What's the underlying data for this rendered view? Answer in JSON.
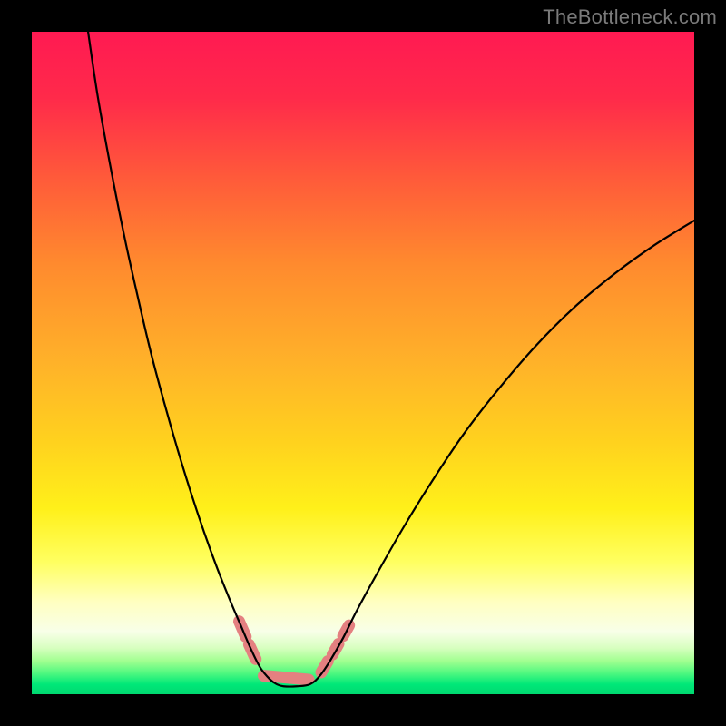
{
  "watermark": "TheBottleneck.com",
  "chart_data": {
    "type": "line",
    "title": "",
    "xlabel": "",
    "ylabel": "",
    "xlim": [
      0,
      100
    ],
    "ylim": [
      0,
      100
    ],
    "gradient_stops": [
      {
        "offset": 0.0,
        "color": "#ff1a52"
      },
      {
        "offset": 0.1,
        "color": "#ff2a4a"
      },
      {
        "offset": 0.22,
        "color": "#ff5a3a"
      },
      {
        "offset": 0.35,
        "color": "#ff8a2e"
      },
      {
        "offset": 0.5,
        "color": "#ffb229"
      },
      {
        "offset": 0.62,
        "color": "#ffd21e"
      },
      {
        "offset": 0.72,
        "color": "#fff01a"
      },
      {
        "offset": 0.8,
        "color": "#ffff60"
      },
      {
        "offset": 0.86,
        "color": "#ffffc0"
      },
      {
        "offset": 0.905,
        "color": "#f8ffe8"
      },
      {
        "offset": 0.93,
        "color": "#d8ffc0"
      },
      {
        "offset": 0.95,
        "color": "#a0ff90"
      },
      {
        "offset": 0.968,
        "color": "#50f880"
      },
      {
        "offset": 0.985,
        "color": "#00e878"
      },
      {
        "offset": 1.0,
        "color": "#00d870"
      }
    ],
    "series": [
      {
        "name": "bottleneck-curve",
        "stroke": "#000000",
        "stroke_width": 2.2,
        "points": [
          {
            "x": 8.5,
            "y": 100.0
          },
          {
            "x": 10.0,
            "y": 90.0
          },
          {
            "x": 12.0,
            "y": 79.0
          },
          {
            "x": 14.0,
            "y": 69.0
          },
          {
            "x": 16.0,
            "y": 60.0
          },
          {
            "x": 18.0,
            "y": 51.5
          },
          {
            "x": 20.0,
            "y": 44.0
          },
          {
            "x": 22.0,
            "y": 37.0
          },
          {
            "x": 24.0,
            "y": 30.5
          },
          {
            "x": 26.0,
            "y": 24.5
          },
          {
            "x": 28.0,
            "y": 19.0
          },
          {
            "x": 30.0,
            "y": 14.0
          },
          {
            "x": 31.5,
            "y": 10.5
          },
          {
            "x": 33.0,
            "y": 7.0
          },
          {
            "x": 34.5,
            "y": 4.0
          },
          {
            "x": 36.0,
            "y": 2.2
          },
          {
            "x": 37.0,
            "y": 1.5
          },
          {
            "x": 38.0,
            "y": 1.2
          },
          {
            "x": 40.0,
            "y": 1.2
          },
          {
            "x": 42.0,
            "y": 1.5
          },
          {
            "x": 43.5,
            "y": 2.8
          },
          {
            "x": 45.0,
            "y": 5.0
          },
          {
            "x": 47.0,
            "y": 8.5
          },
          {
            "x": 49.0,
            "y": 12.5
          },
          {
            "x": 52.0,
            "y": 18.0
          },
          {
            "x": 56.0,
            "y": 25.0
          },
          {
            "x": 60.0,
            "y": 31.5
          },
          {
            "x": 65.0,
            "y": 39.0
          },
          {
            "x": 70.0,
            "y": 45.5
          },
          {
            "x": 76.0,
            "y": 52.5
          },
          {
            "x": 82.0,
            "y": 58.5
          },
          {
            "x": 88.0,
            "y": 63.5
          },
          {
            "x": 94.0,
            "y": 67.8
          },
          {
            "x": 100.0,
            "y": 71.5
          }
        ]
      }
    ],
    "markers": {
      "name": "highlight-segments",
      "stroke": "#e48080",
      "stroke_width": 13,
      "segments": [
        {
          "x1": 31.3,
          "y1": 11.0,
          "x2": 32.3,
          "y2": 8.7
        },
        {
          "x1": 32.8,
          "y1": 7.5,
          "x2": 33.8,
          "y2": 5.3
        },
        {
          "x1": 35.0,
          "y1": 2.8,
          "x2": 41.8,
          "y2": 2.2
        },
        {
          "x1": 43.7,
          "y1": 3.3,
          "x2": 44.7,
          "y2": 5.0
        },
        {
          "x1": 45.4,
          "y1": 6.0,
          "x2": 46.3,
          "y2": 7.6
        },
        {
          "x1": 47.0,
          "y1": 8.8,
          "x2": 47.9,
          "y2": 10.4
        }
      ]
    }
  }
}
